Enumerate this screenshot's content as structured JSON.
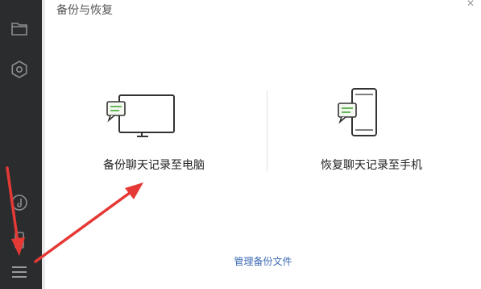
{
  "window": {
    "title": "备份与恢复"
  },
  "sidebar": {
    "items": [
      {
        "icon": "folder-icon"
      },
      {
        "icon": "mini-program-icon"
      },
      {
        "icon": "music-icon"
      },
      {
        "icon": "phone-icon"
      },
      {
        "icon": "menu-icon"
      }
    ]
  },
  "options": {
    "backup_label": "备份聊天记录至电脑",
    "restore_label": "恢复聊天记录至手机"
  },
  "footer": {
    "manage_label": "管理备份文件"
  },
  "colors": {
    "sidebar_bg": "#2b2c2e",
    "accent_green": "#5bb04b",
    "link_blue": "#3d6bb3",
    "annotation_red": "#e53935"
  }
}
